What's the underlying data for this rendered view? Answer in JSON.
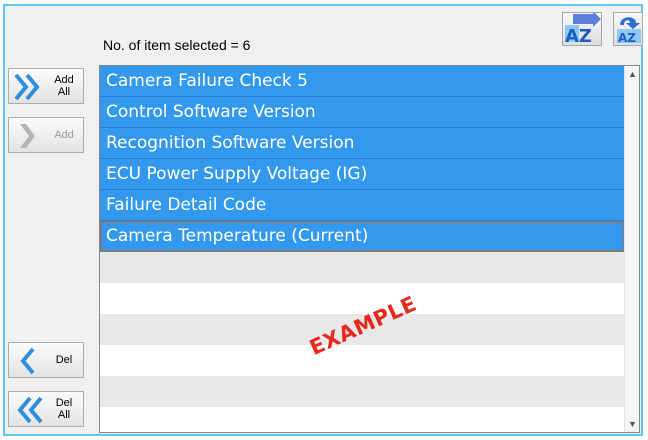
{
  "header": {
    "selected_count_text": "No. of item selected = 6"
  },
  "toolbar": {
    "sort_ascending_icon": "sort-a-z-icon",
    "sort_descending_icon": "sort-z-a-icon",
    "sort_label": "AZ"
  },
  "side_buttons": {
    "add_all": {
      "line1": "Add",
      "line2": "All"
    },
    "add": {
      "label": "Add",
      "enabled": false
    },
    "del": {
      "label": "Del"
    },
    "del_all": {
      "line1": "Del",
      "line2": "All"
    }
  },
  "list": {
    "selected_items": [
      "Camera Failure Check 5",
      "Control Software Version",
      "Recognition Software Version",
      "ECU Power Supply Voltage (IG)",
      "Failure Detail Code",
      "Camera Temperature (Current)"
    ],
    "focused_index": 5,
    "empty_rows": 6
  },
  "watermark": "EXAMPLE",
  "colors": {
    "frame_border": "#5fc6ee",
    "selection": "#3399ee",
    "arrow": "#2f8fde",
    "arrow_disabled": "#b5b5b5",
    "watermark": "#e8281d"
  }
}
